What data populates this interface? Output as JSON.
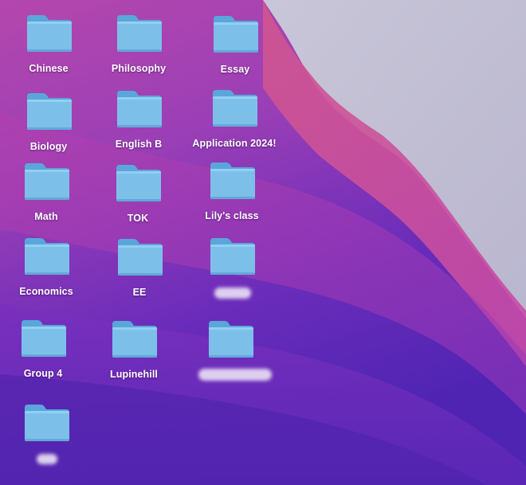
{
  "desktop": {
    "folders": [
      {
        "label": "Chinese",
        "icon": "folder-icon"
      },
      {
        "label": "Philosophy",
        "icon": "folder-icon"
      },
      {
        "label": "Essay",
        "icon": "folder-icon"
      },
      {
        "label": "Biology",
        "icon": "folder-icon"
      },
      {
        "label": "English B",
        "icon": "folder-icon"
      },
      {
        "label": "Application 2024!",
        "icon": "folder-icon"
      },
      {
        "label": "Math",
        "icon": "folder-icon"
      },
      {
        "label": "TOK",
        "icon": "folder-icon"
      },
      {
        "label": "Lily's class",
        "icon": "folder-icon"
      },
      {
        "label": "Economics",
        "icon": "folder-icon"
      },
      {
        "label": "EE",
        "icon": "folder-icon"
      },
      {
        "label": "",
        "icon": "folder-icon",
        "label_hidden": true
      },
      {
        "label": "Group 4",
        "icon": "folder-icon"
      },
      {
        "label": "Lupinehill",
        "icon": "folder-icon"
      },
      {
        "label": "",
        "icon": "folder-icon",
        "label_hidden": true
      },
      {
        "label": "",
        "icon": "folder-icon",
        "label_hidden": true
      }
    ]
  },
  "colors": {
    "folder_body": "#7cc0ea",
    "folder_tab": "#5aa6db",
    "label_text": "#ffffff",
    "wallpaper_purple": "#5a2bb8",
    "wallpaper_magenta": "#c346b7",
    "wallpaper_grey": "#c4c3d6"
  }
}
